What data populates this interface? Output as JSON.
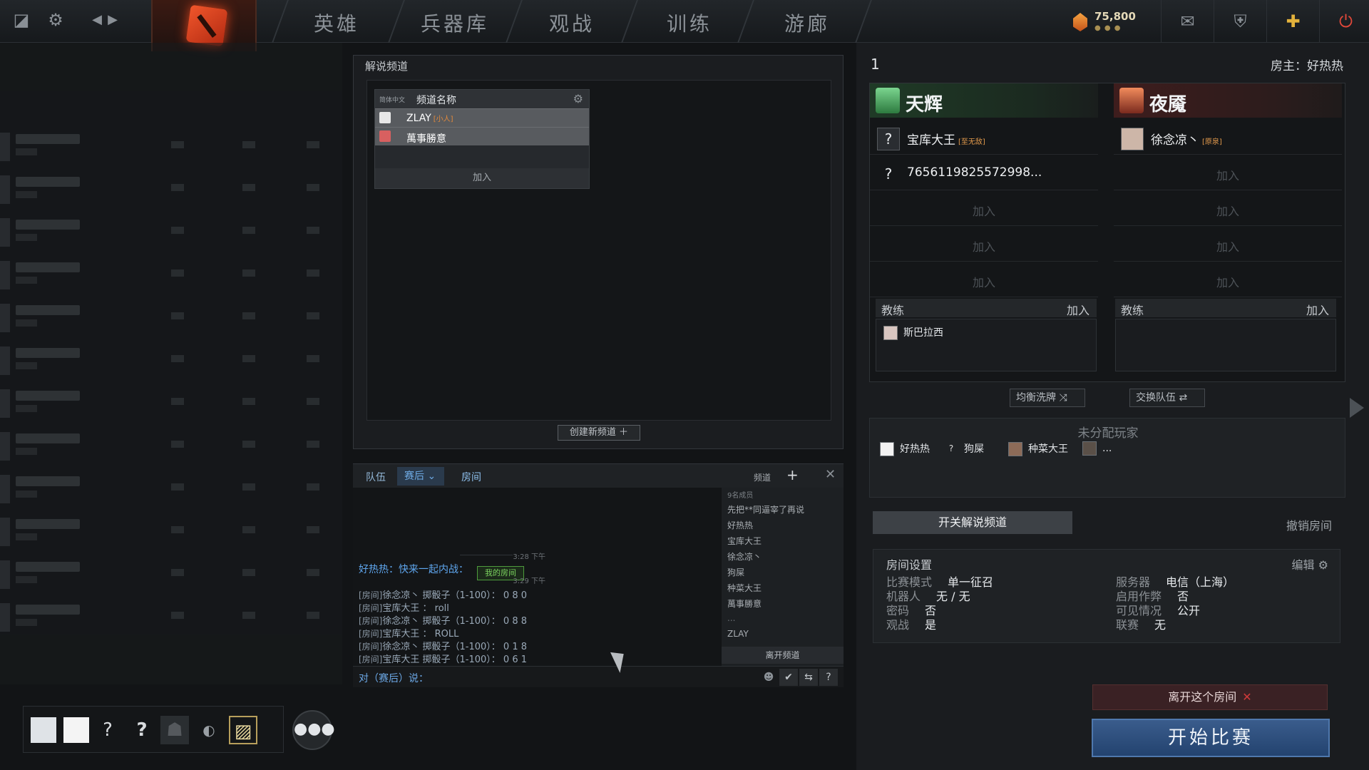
{
  "topbar": {
    "nav": [
      "英雄",
      "兵器库",
      "观战",
      "训练",
      "游廊"
    ],
    "gold": "75,800"
  },
  "channels": {
    "title": "解说频道",
    "lang": "简体中文",
    "header": "频道名称",
    "rows": [
      {
        "name": "ZLAY",
        "tag": "[小人]"
      },
      {
        "name": "萬事勝意",
        "tag": ""
      }
    ],
    "join": "加入",
    "create": "创建新频道 ＋"
  },
  "chat": {
    "tabs": {
      "team": "队伍",
      "post": "赛后",
      "room": "房间"
    },
    "channels_label": "频道",
    "time1": "3:28 下午",
    "time2": "3:29 下午",
    "invite": "好热热：快来一起内战：",
    "invite_btn": "我的房间",
    "messages": [
      {
        "room": "[房间]",
        "text": "徐念凉丶 掷骰子（1-100）： 0 8 0"
      },
      {
        "room": "[房间]",
        "text": "宝库大王 ： roll"
      },
      {
        "room": "[房间]",
        "text": "徐念凉丶 掷骰子（1-100）： 0 8 8"
      },
      {
        "room": "[房间]",
        "text": "宝库大王 ： ROLL"
      },
      {
        "room": "[房间]",
        "text": "徐念凉丶 掷骰子（1-100）： 0 1 8"
      },
      {
        "room": "[房间]",
        "text": "宝库大王 掷骰子（1-100）： 0 6 1"
      }
    ],
    "input_label": "对（赛后）说：",
    "member_count": "9名成员",
    "members": [
      "先把**同逼宰了再说",
      "好热热",
      "宝库大王",
      "徐念凉丶",
      "狗屎",
      "种菜大王",
      "萬事勝意",
      "...",
      "ZLAY"
    ],
    "leave_channel": "离开频道"
  },
  "lobby": {
    "number": "1",
    "host": "房主：好热热",
    "radiant": {
      "name": "天辉",
      "players": [
        {
          "icon": "?",
          "name": "宝库大王",
          "tag": "[至无敌]"
        },
        {
          "icon": "?",
          "name": "7656119825572998...",
          "tag": ""
        }
      ],
      "empty_slots": [
        "加入",
        "加入",
        "加入"
      ],
      "coach_label": "教练",
      "coach_join": "加入",
      "coach": "斯巴拉西"
    },
    "dire": {
      "name": "夜魇",
      "players": [
        {
          "icon": "",
          "name": "徐念凉丶",
          "tag": "[原泉]"
        }
      ],
      "empty_slots": [
        "加入",
        "加入",
        "加入",
        "加入"
      ],
      "coach_label": "教练",
      "coach_join": "加入"
    },
    "balance": "均衡洗牌",
    "swap": "交换队伍",
    "unassigned_title": "未分配玩家",
    "unassigned": [
      {
        "icon": "",
        "name": "好热热"
      },
      {
        "icon": "?",
        "name": "狗屎"
      },
      {
        "icon": "",
        "name": "种菜大王"
      },
      {
        "icon": "",
        "name": "..."
      }
    ],
    "commentary_toggle": "开关解说频道",
    "dissolve": "撤销房间",
    "settings": {
      "title": "房间设置",
      "edit": "编辑",
      "left": [
        {
          "k": "比赛模式",
          "v": "单一征召"
        },
        {
          "k": "机器人",
          "v": "无 / 无"
        },
        {
          "k": "密码",
          "v": "否"
        },
        {
          "k": "观战",
          "v": "是"
        }
      ],
      "right": [
        {
          "k": "服务器",
          "v": "电信（上海）"
        },
        {
          "k": "启用作弊",
          "v": "否"
        },
        {
          "k": "可见情况",
          "v": "公开"
        },
        {
          "k": "联赛",
          "v": "无"
        }
      ]
    },
    "leave_room": "离开这个房间",
    "start": "开始比赛"
  },
  "colors": {
    "accent": "#3a5c8c",
    "radiant": "#2d7a3f",
    "dire": "#7a2a1e",
    "link": "#5fa6ee"
  }
}
